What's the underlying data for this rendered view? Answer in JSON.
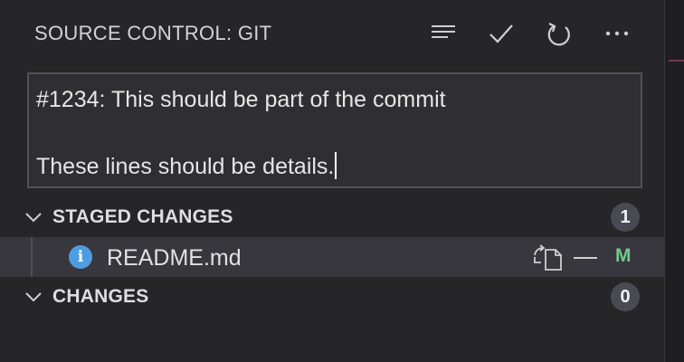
{
  "header": {
    "title": "SOURCE CONTROL: GIT",
    "icons": [
      "view-as-list-icon",
      "commit-checkmark-icon",
      "refresh-icon",
      "more-actions-icon"
    ]
  },
  "commit_message": {
    "line1": "#1234: This should be part of the commit",
    "line2": "",
    "line3": "These lines should be details."
  },
  "staged": {
    "label": "STAGED CHANGES",
    "count": "1",
    "files": [
      {
        "name": "README.md",
        "status": "M",
        "icon": "info-icon"
      }
    ]
  },
  "changes": {
    "label": "CHANGES",
    "count": "0"
  },
  "colors": {
    "panel_bg": "#262629",
    "selected_row_bg": "#37373d",
    "modified_status": "#73c991",
    "info_icon": "#4d9de0"
  }
}
